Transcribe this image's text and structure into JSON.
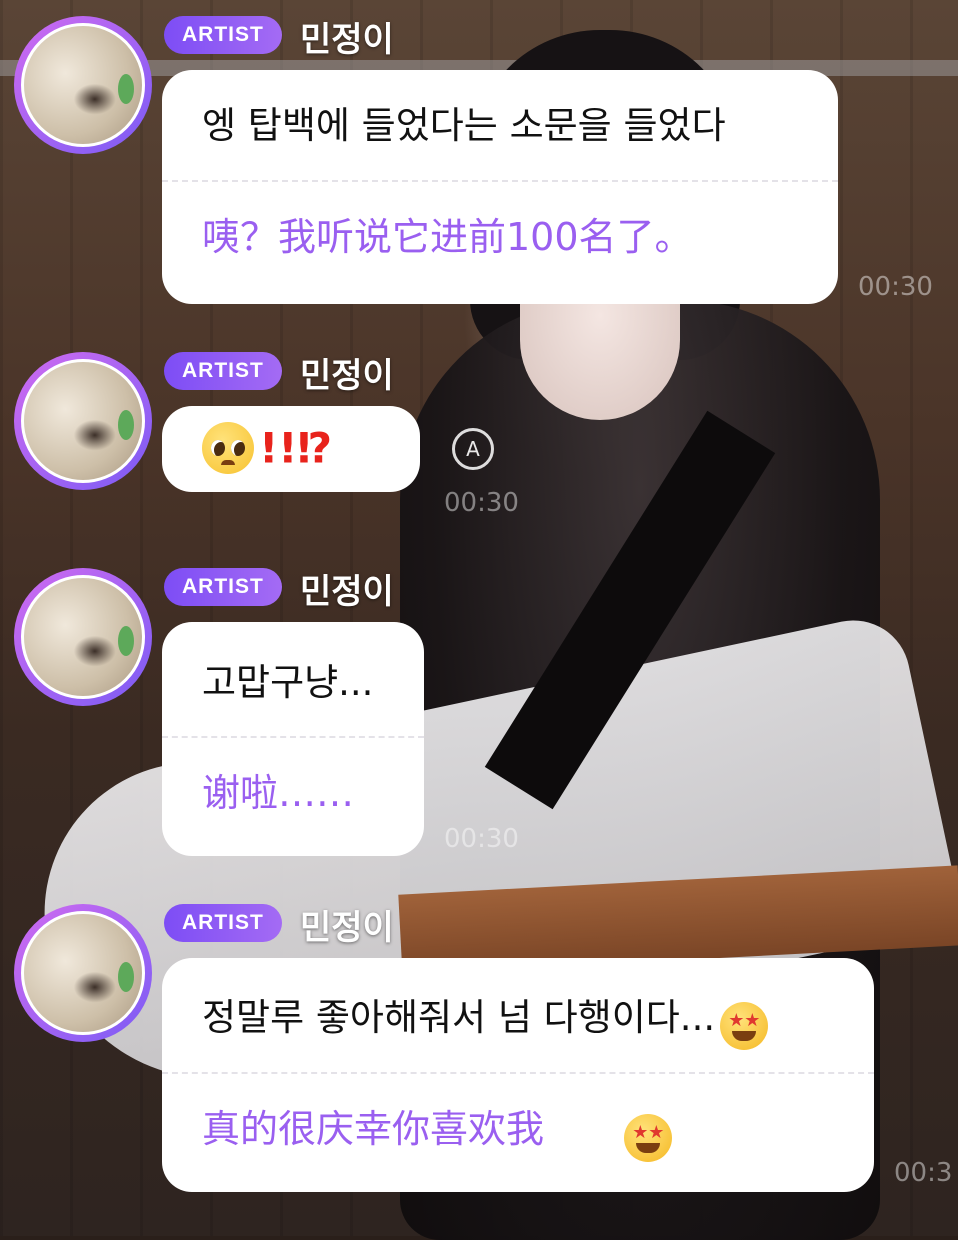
{
  "messages": [
    {
      "badge": "ARTIST",
      "name": "민정이",
      "original": "엥 탑백에 들었다는 소문을 들었다",
      "translation": "咦？我听说它进前100名了。"
    },
    {
      "badge": "ARTIST",
      "name": "민정이",
      "original_marks": "!!⁉",
      "emoji": "pleading-face-emoji"
    },
    {
      "badge": "ARTIST",
      "name": "민정이",
      "original": "고맙구냥...",
      "translation": "谢啦……"
    },
    {
      "badge": "ARTIST",
      "name": "민정이",
      "original": "정말루 좋아해줘서 넘 다행이다...",
      "translation": "真的很庆幸你喜欢我",
      "emoji": "star-struck-emoji"
    }
  ],
  "timestamps": [
    "00:30",
    "00:30",
    "00:30",
    "00:3"
  ],
  "translate_icon_glyph": "A",
  "colors": {
    "badge_start": "#7d4df5",
    "badge_end": "#a46bf4",
    "translation_text": "#9a5ff0",
    "avatar_ring": "#b866f2"
  }
}
